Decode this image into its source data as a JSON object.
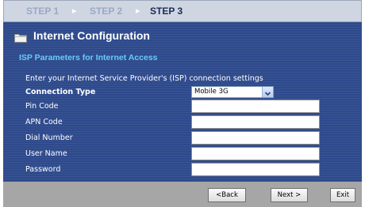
{
  "steps": {
    "step1": "STEP 1",
    "step2": "STEP 2",
    "step3": "STEP 3",
    "separator": "▸"
  },
  "header": {
    "title": "Internet Configuration",
    "icon": "folder-icon"
  },
  "section": {
    "title": "ISP Parameters for Internet Access"
  },
  "form": {
    "intro": "Enter your Internet Service Provider's (ISP) connection settings",
    "connection_type_label": "Connection Type",
    "connection_type_value": "Mobile 3G",
    "fields": [
      {
        "label": "Pin Code",
        "value": ""
      },
      {
        "label": "APN Code",
        "value": ""
      },
      {
        "label": "Dial Number",
        "value": ""
      },
      {
        "label": "User Name",
        "value": ""
      },
      {
        "label": "Password",
        "value": ""
      }
    ]
  },
  "footer": {
    "back_label": "<Back",
    "next_label": "Next >",
    "exit_label": "Exit"
  },
  "colors": {
    "panel_bg": "#2e4a8c",
    "section_title": "#66ccff",
    "footer_bg": "#a6a6a6"
  }
}
